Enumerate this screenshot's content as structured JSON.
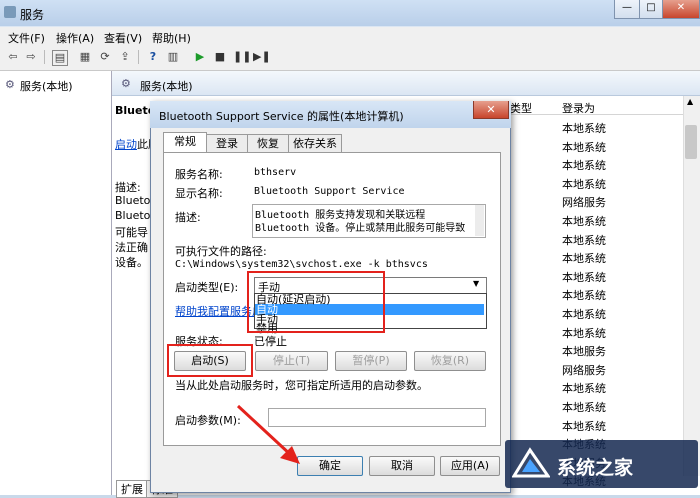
{
  "app": {
    "title": "服务"
  },
  "menu": [
    "文件(F)",
    "操作(A)",
    "查看(V)",
    "帮助(H)"
  ],
  "window_buttons": {
    "min": "—",
    "max": "□",
    "close": "✕"
  },
  "left_pane": {
    "tree_label": "服务(本地)"
  },
  "right_pane": {
    "header": "服务(本地)",
    "service_title_partial": "Bluetoo",
    "link_partial": "启动",
    "link_rest": "此服",
    "desc_partial": [
      "描述:",
      "Blueto",
      "Blueto",
      "可能导",
      "法正确",
      "设备。"
    ],
    "columns": {
      "type": "类型",
      "logon": "登录为"
    },
    "logon_rows": [
      "本地系统",
      "本地系统",
      "本地系统",
      "本地系统",
      "网络服务",
      "本地系统",
      "本地系统",
      "本地系统",
      "本地系统",
      "本地系统",
      "本地系统",
      "本地系统",
      "本地服务",
      "网络服务",
      "本地系统",
      "本地系统",
      "本地系统",
      "本地系统",
      "本地服务",
      "本地系统"
    ],
    "bottom_tabs": [
      "扩展",
      "标准"
    ]
  },
  "dialog": {
    "title": "Bluetooth Support Service 的属性(本地计算机)",
    "close": "✕",
    "tabs": [
      "常规",
      "登录",
      "恢复",
      "依存关系"
    ],
    "service_name_label": "服务名称:",
    "service_name": "bthserv",
    "display_name_label": "显示名称:",
    "display_name": "Bluetooth Support Service",
    "description_label": "描述:",
    "description_lines": [
      "Bluetooth 服务支持发现和关联远程",
      "Bluetooth 设备。停止或禁用此服务可能导致"
    ],
    "exe_path_label": "可执行文件的路径:",
    "exe_path": "C:\\Windows\\system32\\svchost.exe -k bthsvcs",
    "startup_type_label": "启动类型(E):",
    "startup_type_value": "手动",
    "startup_options": [
      "自动(延迟启动)",
      "自动",
      "手动",
      "禁用"
    ],
    "help_link": "帮助我配置服务启动",
    "status_label": "服务状态:",
    "status_value": "已停止",
    "buttons": {
      "start": "启动(S)",
      "stop": "停止(T)",
      "pause": "暂停(P)",
      "resume": "恢复(R)"
    },
    "hint": "当从此处启动服务时，您可指定所适用的启动参数。",
    "param_label": "启动参数(M):",
    "param_value": "",
    "footer": {
      "ok": "确定",
      "cancel": "取消",
      "apply": "应用(A)"
    }
  },
  "watermark": {
    "text": "系统之家"
  },
  "colors": {
    "highlight": "#3399ff",
    "annotation_red": "#e3221c"
  }
}
